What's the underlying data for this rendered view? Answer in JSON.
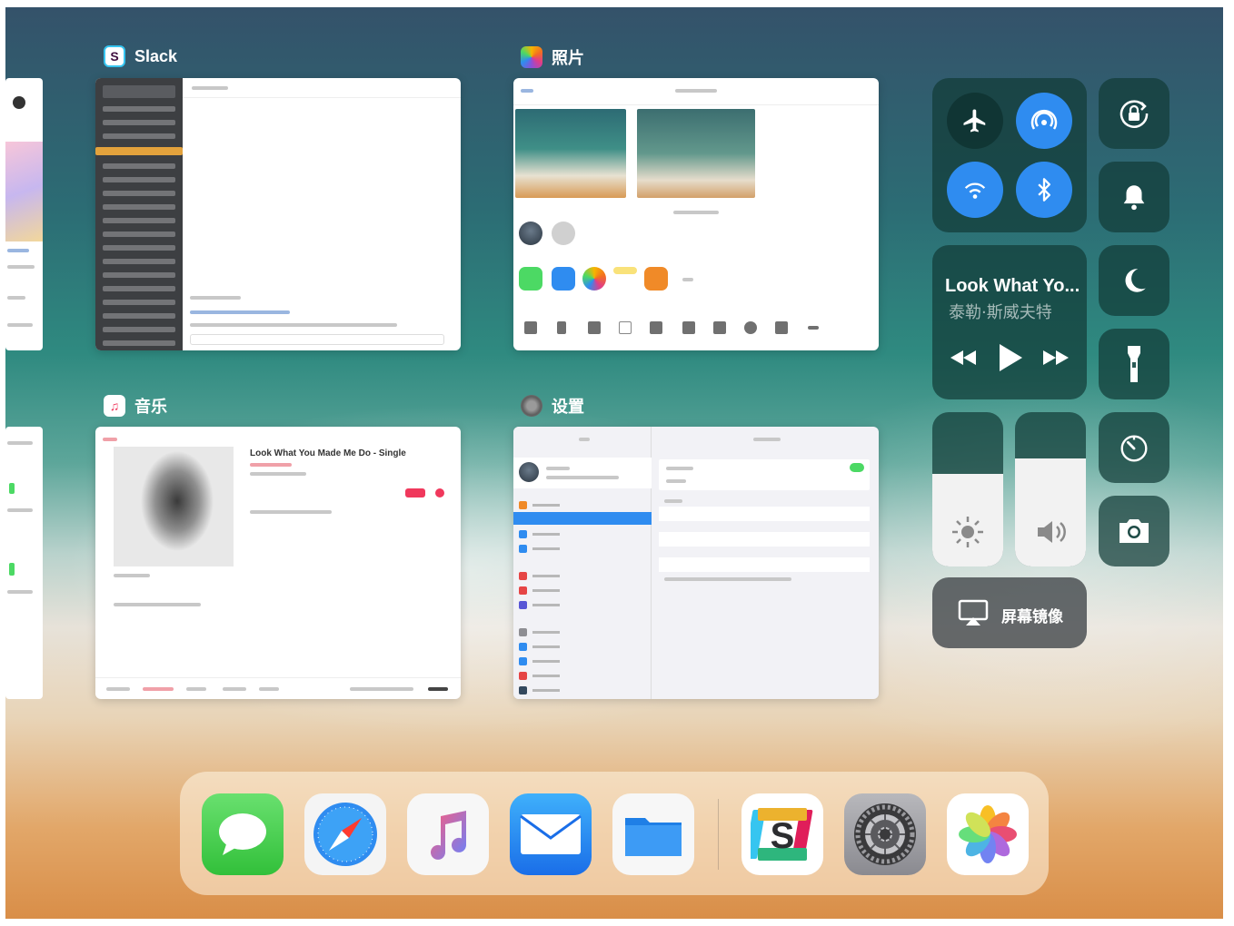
{
  "switcher": {
    "cards": [
      {
        "id": "slack",
        "title": "Slack",
        "icon": "slack-app-icon"
      },
      {
        "id": "photos",
        "title": "照片",
        "icon": "photos-app-icon"
      },
      {
        "id": "music",
        "title": "音乐",
        "icon": "music-app-icon"
      },
      {
        "id": "settings",
        "title": "设置",
        "icon": "settings-app-icon"
      }
    ],
    "music_card": {
      "song_title": "Look What You Made Me Do - Single"
    }
  },
  "control_center": {
    "toggles": [
      {
        "name": "airplane-mode",
        "icon": "airplane-icon",
        "on": false
      },
      {
        "name": "airdrop",
        "icon": "airdrop-icon",
        "on": true
      },
      {
        "name": "wifi",
        "icon": "wifi-icon",
        "on": true
      },
      {
        "name": "bluetooth",
        "icon": "bluetooth-icon",
        "on": true
      }
    ],
    "now_playing": {
      "title": "Look What Yo...",
      "artist": "泰勒·斯威夫特"
    },
    "brightness": 0.6,
    "volume": 0.7,
    "screen_mirroring_label": "屏幕镜像",
    "accent_color": "#2f8cf0"
  },
  "dock": {
    "apps": [
      "messages",
      "safari",
      "music",
      "mail",
      "files",
      "slack",
      "settings",
      "photos"
    ]
  }
}
